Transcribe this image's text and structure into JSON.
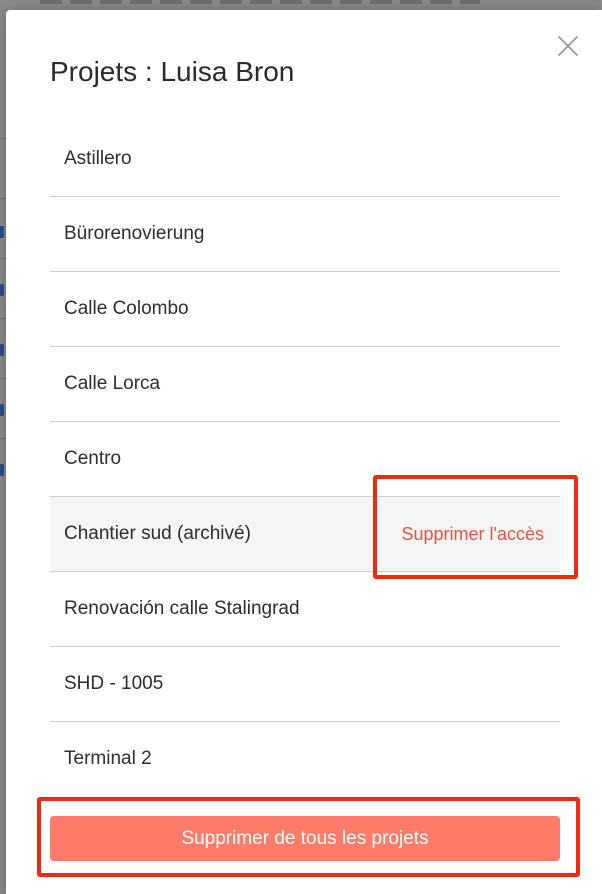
{
  "modal": {
    "title": "Projets : Luisa Bron",
    "close_icon": "close-icon"
  },
  "projects": [
    {
      "name": "Astillero"
    },
    {
      "name": "Bürorenovierung"
    },
    {
      "name": "Calle Colombo"
    },
    {
      "name": "Calle Lorca"
    },
    {
      "name": "Centro"
    },
    {
      "name": "Chantier sud (archivé)",
      "hovered": true,
      "action_label": "Supprimer l'accès"
    },
    {
      "name": "Renovación calle Stalingrad"
    },
    {
      "name": "SHD - 1005"
    },
    {
      "name": "Terminal 2"
    }
  ],
  "remove_all_label": "Supprimer de tous les projets",
  "colors": {
    "accent_danger": "#f0533c",
    "button_bg": "#ff7b69",
    "annotation_red": "#f22a12",
    "hover_row_bg": "#f4f5f6"
  }
}
